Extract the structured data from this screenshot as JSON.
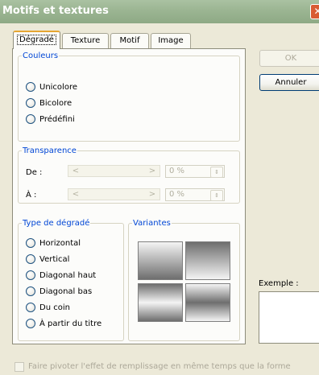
{
  "window": {
    "title": "Motifs et textures",
    "close_glyph": "✕"
  },
  "tabs": [
    {
      "label": "Dégradé",
      "active": true
    },
    {
      "label": "Texture",
      "active": false
    },
    {
      "label": "Motif",
      "active": false
    },
    {
      "label": "Image",
      "active": false
    }
  ],
  "couleurs": {
    "legend": "Couleurs",
    "options": [
      {
        "label": "Unicolore",
        "selected": false
      },
      {
        "label": "Bicolore",
        "selected": false
      },
      {
        "label": "Prédéfini",
        "selected": false
      }
    ]
  },
  "transparence": {
    "legend": "Transparence",
    "de_label": "De :",
    "a_label": "À :",
    "de_value": "0 %",
    "a_value": "0 %",
    "arrow_left": "<",
    "arrow_right": ">",
    "spin_glyph": "⇕"
  },
  "type_degrade": {
    "legend": "Type de dégradé",
    "options": [
      {
        "label": "Horizontal",
        "selected": false
      },
      {
        "label": "Vertical",
        "selected": false
      },
      {
        "label": "Diagonal haut",
        "selected": false
      },
      {
        "label": "Diagonal bas",
        "selected": false
      },
      {
        "label": "Du coin",
        "selected": false
      },
      {
        "label": "À partir du titre",
        "selected": false
      }
    ]
  },
  "variantes": {
    "legend": "Variantes"
  },
  "buttons": {
    "ok": "OK",
    "annuler": "Annuler"
  },
  "example": {
    "label": "Exemple :"
  },
  "rotate_checkbox": {
    "label": "Faire pivoter l'effet de remplissage en même temps que la forme",
    "checked": false,
    "enabled": false
  },
  "colors": {
    "titlebar": "#9bb592",
    "close": "#d95b34",
    "legend_text": "#0046d5",
    "dialog_bg": "#ece9d8",
    "tab_highlight": "#e6a632"
  }
}
